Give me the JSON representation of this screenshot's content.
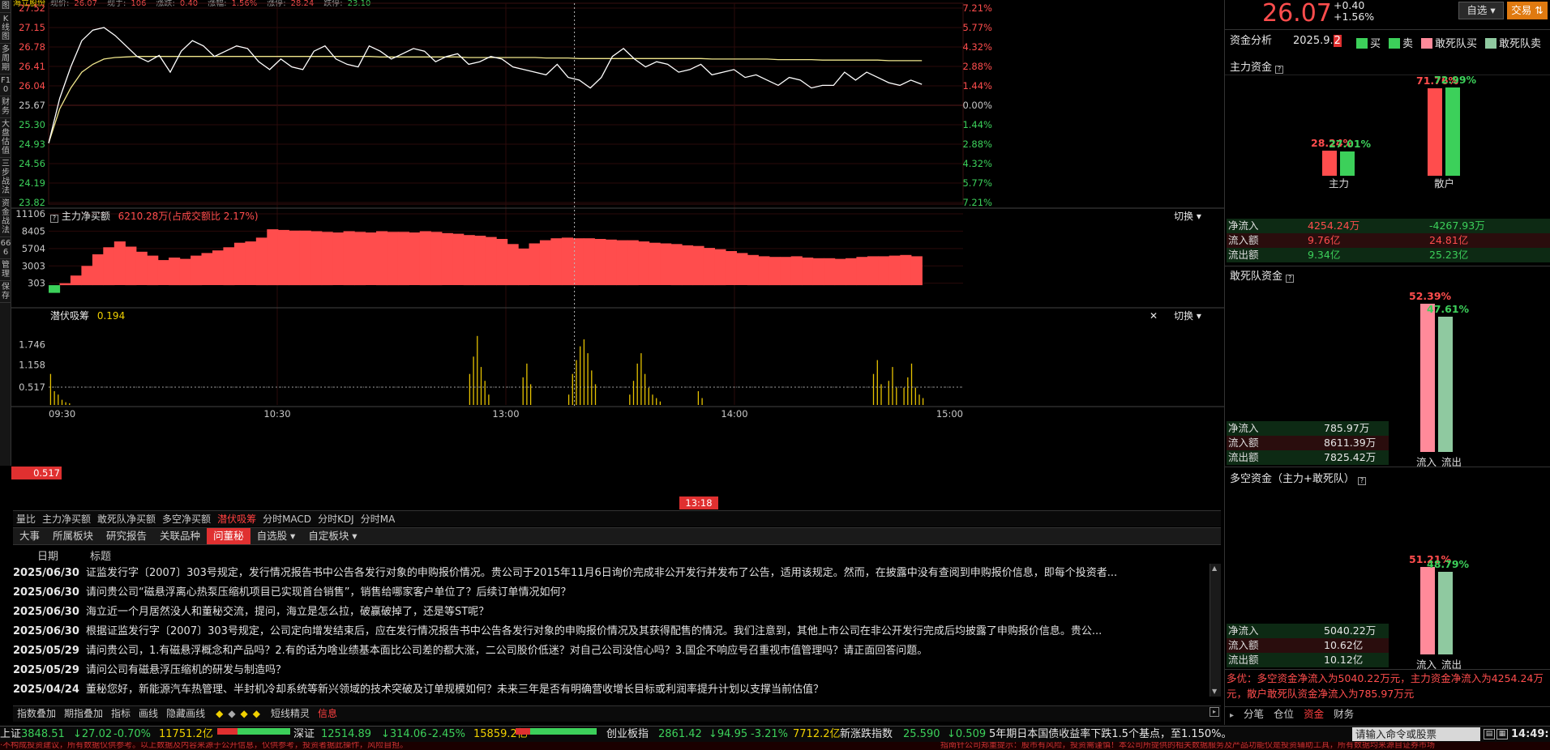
{
  "top_strip": {
    "name": "海立股份",
    "items": [
      {
        "label": "现价:",
        "value": "26.07"
      },
      {
        "label": "现手:",
        "value": "106"
      },
      {
        "label": "涨跌:",
        "value": "0.40"
      },
      {
        "label": "涨幅:",
        "value": "1.56%"
      },
      {
        "label": "涨停:",
        "value": "28.24"
      },
      {
        "label": "跌停:",
        "value": "23.10"
      }
    ]
  },
  "left_sidebar": [
    "图",
    "K线图",
    "多周期",
    "F10",
    "财务",
    "大盘估值",
    "三步战法",
    "资金战法",
    "666",
    "管理",
    "保存"
  ],
  "price_chart": {
    "y_left": [
      "27.52",
      "27.15",
      "26.78",
      "26.41",
      "26.04",
      "25.67",
      "25.30",
      "24.93",
      "24.56",
      "24.19",
      "23.82"
    ],
    "y_right": [
      "7.21%",
      "5.77%",
      "4.32%",
      "2.88%",
      "1.44%",
      "0.00%",
      "1.44%",
      "2.88%",
      "4.32%",
      "5.77%",
      "7.21%"
    ],
    "ylim": [
      23.82,
      27.52
    ],
    "prev_close": 25.67,
    "price_series": [
      24.95,
      25.8,
      26.4,
      26.9,
      27.1,
      27.15,
      27.0,
      26.8,
      26.6,
      26.5,
      26.62,
      26.3,
      26.7,
      26.9,
      26.8,
      26.6,
      26.7,
      26.8,
      26.75,
      26.5,
      26.35,
      26.55,
      26.4,
      26.35,
      26.7,
      26.8,
      26.55,
      26.45,
      26.4,
      26.8,
      26.7,
      26.55,
      26.65,
      26.75,
      26.7,
      26.5,
      26.6,
      26.65,
      26.45,
      26.5,
      26.6,
      26.55,
      26.4,
      26.35,
      26.3,
      26.25,
      26.45,
      26.2,
      26.15,
      26.0,
      26.2,
      26.6,
      26.75,
      26.55,
      26.4,
      26.5,
      26.45,
      26.3,
      26.35,
      26.45,
      26.25,
      26.3,
      26.35,
      26.2,
      26.25,
      26.15,
      26.05,
      26.2,
      26.15,
      26.0,
      26.05,
      26.05,
      26.3,
      26.15,
      26.3,
      26.2,
      26.1,
      26.05,
      26.15,
      26.07
    ],
    "avg_series": [
      24.95,
      25.6,
      26.0,
      26.3,
      26.45,
      26.55,
      26.58,
      26.59,
      26.6,
      26.6,
      26.6,
      26.6,
      26.6,
      26.6,
      26.6,
      26.6,
      26.6,
      26.6,
      26.6,
      26.6,
      26.6,
      26.6,
      26.6,
      26.6,
      26.6,
      26.6,
      26.6,
      26.6,
      26.6,
      26.6,
      26.59,
      26.59,
      26.59,
      26.59,
      26.59,
      26.59,
      26.59,
      26.59,
      26.58,
      26.58,
      26.58,
      26.58,
      26.58,
      26.58,
      26.58,
      26.57,
      26.57,
      26.57,
      26.56,
      26.56,
      26.56,
      26.56,
      26.56,
      26.56,
      26.56,
      26.56,
      26.56,
      26.56,
      26.56,
      26.56,
      26.55,
      26.55,
      26.55,
      26.55,
      26.55,
      26.55,
      26.54,
      26.54,
      26.54,
      26.54,
      26.53,
      26.53,
      26.53,
      26.53,
      26.53,
      26.53,
      26.52,
      26.52,
      26.52,
      26.52
    ]
  },
  "main_flow": {
    "title": "主力净买额",
    "value_text": "6210.28万(占成交额比 2.17%)",
    "switch_label": "切换",
    "y_labels": [
      "11106",
      "8405",
      "5704",
      "3003",
      "303"
    ],
    "ylim": [
      -1000,
      11106
    ],
    "series": [
      -1200,
      303,
      1500,
      3003,
      4800,
      5900,
      6800,
      6000,
      5200,
      4600,
      3900,
      4300,
      4100,
      4600,
      5000,
      5400,
      5900,
      6600,
      6800,
      7400,
      8700,
      8600,
      8500,
      8500,
      8400,
      8300,
      8200,
      8400,
      8300,
      8200,
      8400,
      8300,
      8300,
      8200,
      8400,
      8300,
      8100,
      8000,
      7800,
      7700,
      7500,
      7200,
      6400,
      5700,
      6500,
      7000,
      7300,
      7400,
      7300,
      7300,
      7200,
      7100,
      7000,
      7000,
      6800,
      6600,
      6500,
      6400,
      6200,
      6100,
      5800,
      5600,
      5300,
      5000,
      4700,
      4500,
      4400,
      4400,
      4500,
      4300,
      4200,
      4200,
      4100,
      4200,
      4400,
      4500,
      4500,
      4600,
      4700,
      4500
    ]
  },
  "latent": {
    "title": "潜伏吸筹",
    "value": "0.194",
    "switch_label": "切换",
    "close_icon": "close-icon",
    "y_labels": [
      "1.746",
      "1.158",
      "0.517"
    ],
    "marker_value": "0.517",
    "ylim": [
      0,
      2.3
    ],
    "bars": [
      [
        0,
        0.9
      ],
      [
        1,
        0.4
      ],
      [
        2,
        0.3
      ],
      [
        3,
        0.15
      ],
      [
        4,
        0.08
      ],
      [
        5,
        0.05
      ],
      [
        110,
        0.9
      ],
      [
        111,
        1.4
      ],
      [
        112,
        2.0
      ],
      [
        113,
        1.1
      ],
      [
        114,
        0.7
      ],
      [
        115,
        0.3
      ],
      [
        124,
        0.8
      ],
      [
        125,
        1.2
      ],
      [
        126,
        0.6
      ],
      [
        136,
        0.3
      ],
      [
        137,
        0.9
      ],
      [
        138,
        1.3
      ],
      [
        139,
        1.7
      ],
      [
        140,
        1.9
      ],
      [
        141,
        1.5
      ],
      [
        142,
        1.0
      ],
      [
        143,
        0.6
      ],
      [
        152,
        0.3
      ],
      [
        153,
        0.7
      ],
      [
        154,
        1.2
      ],
      [
        155,
        1.5
      ],
      [
        156,
        0.9
      ],
      [
        157,
        0.5
      ],
      [
        158,
        0.3
      ],
      [
        159,
        0.2
      ],
      [
        160,
        0.1
      ],
      [
        170,
        0.4
      ],
      [
        171,
        0.2
      ],
      [
        216,
        0.9
      ],
      [
        217,
        1.3
      ],
      [
        218,
        0.6
      ],
      [
        220,
        0.7
      ],
      [
        221,
        1.1
      ],
      [
        222,
        0.5
      ],
      [
        224,
        0.5
      ],
      [
        225,
        0.8
      ],
      [
        226,
        1.2
      ],
      [
        227,
        0.5
      ],
      [
        228,
        0.3
      ],
      [
        229,
        0.2
      ]
    ],
    "bar_count": 240
  },
  "time_axis": {
    "labels": [
      "09:30",
      "10:30",
      "13:00",
      "14:00",
      "15:00"
    ],
    "cursor_label": "13:18"
  },
  "indicator_tabs": [
    "量比",
    "主力净买额",
    "敢死队净买额",
    "多空净买额",
    "潜伏吸筹",
    "分时MACD",
    "分时KDJ",
    "分时MA"
  ],
  "indicator_active": 4,
  "info_tabs": [
    "大事",
    "所属板块",
    "研究报告",
    "关联品种",
    "问董秘",
    "自选股 ▾",
    "自定板块 ▾"
  ],
  "info_active": 4,
  "qa_header": {
    "date": "日期",
    "title": "标题"
  },
  "qa_rows": [
    {
      "date": "2025/06/30",
      "text": "证监发行字〔2007〕303号规定，发行情况报告书中公告各发行对象的申购报价情况。贵公司于2015年11月6日询价完成非公开发行并发布了公告，适用该规定。然而，在披露中没有查阅到申购报价信息，即每个投资者..."
    },
    {
      "date": "2025/06/30",
      "text": "请问贵公司“磁悬浮离心热泵压缩机项目已实现首台销售”，销售给哪家客户单位了？后续订单情况如何？"
    },
    {
      "date": "2025/06/30",
      "text": "海立近一个月居然没人和董秘交流，提问，海立是怎么拉，破赢破掉了，还是等ST呢？"
    },
    {
      "date": "2025/06/30",
      "text": "根据证监发行字〔2007〕303号规定，公司定向增发结束后，应在发行情况报告书中公告各发行对象的申购报价情况及其获得配售的情况。我们注意到，其他上市公司在非公开发行完成后均披露了申购报价信息。贵公..."
    },
    {
      "date": "2025/05/29",
      "text": "请问贵公司，1.有磁悬浮概念和产品吗？2.有的话为啥业绩基本面比公司差的都大涨，二公司股价低迷？对自己公司没信心吗？3.国企不响应号召重视市值管理吗？请正面回答问题。"
    },
    {
      "date": "2025/05/29",
      "text": "请问公司有磁悬浮压缩机的研发与制造吗？"
    },
    {
      "date": "2025/04/24",
      "text": "董秘您好，新能源汽车热管理、半封机冷却系统等新兴领域的技术突破及订单规模如何？未来三年是否有明确营收增长目标或利润率提升计划以支撑当前估值？"
    }
  ],
  "toolbar": [
    "指数叠加",
    "期指叠加",
    "指标",
    "画线",
    "隐藏画线",
    "短线精灵",
    "信息"
  ],
  "statusbar": {
    "sh_label": "上证",
    "sh_value": "3848.51",
    "sh_chg": "↓27.02",
    "sh_pct": "-0.70%",
    "sh_amt": "11751.2亿",
    "sz_label": "深证",
    "sz_value": "12514.89",
    "sz_chg": "↓314.06",
    "sz_pct": "-2.45%",
    "sz_amt": "15859.2亿",
    "cy_label": "创业板指",
    "cy_value": "2861.42",
    "cy_chg": "↓94.95",
    "cy_pct": "-3.21%",
    "cy_amt": "7712.2亿",
    "xz_label": "新涨跌指数",
    "xz_value": "25.590",
    "xz_chg": "↓0.509",
    "news": "5年期日本国债收益率下跌1.5个基点，至1.150%。",
    "cmd_placeholder": "请输入命令或股票",
    "time": "14:49:13"
  },
  "bottom_band": {
    "left": "‧不构成投资建议，所有数据仅供参考。以上数据及内容来源于公开信息，仅供参考，投资者据此操作，风险自担。",
    "right": "指南针公司郑重提示：股市有风险，投资需谨慎！本公司所提供的相关数据服务及产品功能仅是投资辅助工具，所有数据均来源自证券市场"
  },
  "right_panel": {
    "price": "26.07",
    "change": "+0.40",
    "pct": "+1.56%",
    "btn_auto": "自选 ▾",
    "btn_trade": "交易 ⇅",
    "header_title": "资金分析",
    "header_date": "2025.9.",
    "header_day": "2",
    "legend": [
      {
        "label": "买",
        "color": "#3cd05a"
      },
      {
        "label": "卖",
        "color": "#3cd05a"
      },
      {
        "label": "敢死队买",
        "color": "#ff8a9a"
      },
      {
        "label": "敢死队卖",
        "color": "#8fc9a0"
      }
    ],
    "main_fund": {
      "title": "主力资金",
      "zhuli_in_pct": "28.24%",
      "zhuli_out_pct": "27.01%",
      "sanhu_in_pct": "71.76%",
      "sanhu_out_pct": "72.99%",
      "zhuli_in": 28.24,
      "zhuli_out": 27.01,
      "sanhu_in": 71.76,
      "sanhu_out": 72.99,
      "cat1": "主力",
      "cat2": "散户",
      "rows": [
        {
          "label": "净流入",
          "v1": "4254.24万",
          "v2": "-4267.93万"
        },
        {
          "label": "流入额",
          "v1": "9.76亿",
          "v2": "24.81亿"
        },
        {
          "label": "流出额",
          "v1": "9.34亿",
          "v2": "25.23亿"
        }
      ]
    },
    "gsd_fund": {
      "title": "敢死队资金",
      "in_pct": "52.39%",
      "out_pct": "47.61%",
      "in": 52.39,
      "out": 47.61,
      "rows": [
        {
          "label": "净流入",
          "v": "785.97万"
        },
        {
          "label": "流入额",
          "v": "8611.39万"
        },
        {
          "label": "流出额",
          "v": "7825.42万"
        }
      ],
      "x1": "流入",
      "x2": "流出"
    },
    "dk_fund": {
      "title": "多空资金（主力+敢死队）",
      "in_pct": "51.21%",
      "out_pct": "48.79%",
      "in": 51.21,
      "out": 48.79,
      "rows": [
        {
          "label": "净流入",
          "v": "5040.22万"
        },
        {
          "label": "流入额",
          "v": "10.62亿"
        },
        {
          "label": "流出额",
          "v": "10.12亿"
        }
      ],
      "x1": "流入",
      "x2": "流出"
    },
    "summary": "多优：多空资金净流入为5040.22万元，主力资金净流入为4254.24万元，散户敢死队资金净流入为785.97万元",
    "bottom_tabs": [
      "分笔",
      "仓位",
      "资金",
      "财务"
    ],
    "bottom_active": 2
  }
}
